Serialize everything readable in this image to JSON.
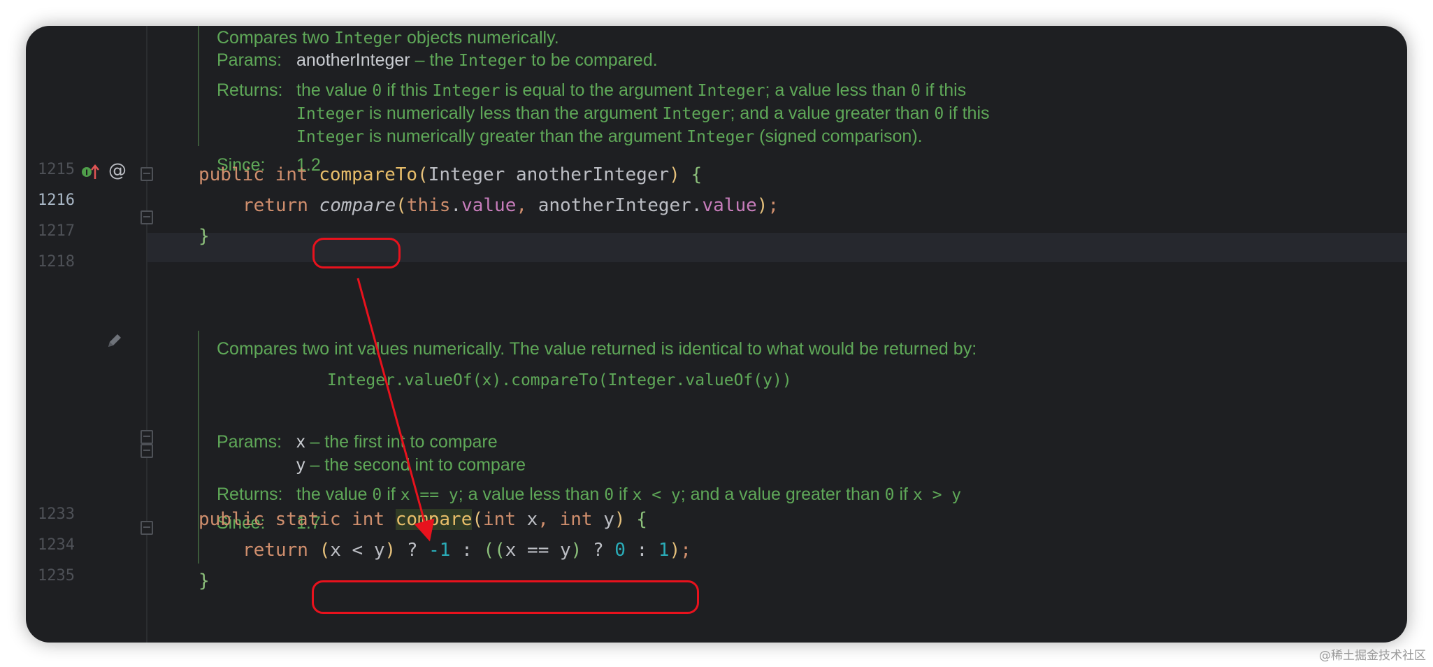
{
  "line_numbers": {
    "l1215": "1215",
    "l1216": "1216",
    "l1217": "1217",
    "l1218": "1218",
    "l1233": "1233",
    "l1234": "1234",
    "l1235": "1235"
  },
  "doc1": {
    "summary_a": "Compares two ",
    "summary_code": "Integer",
    "summary_b": " objects numerically.",
    "params_label": "Params:",
    "param_name": "anotherInteger",
    "param_a": " – the ",
    "param_code": "Integer",
    "param_b": " to be compared.",
    "returns_label": "Returns:",
    "ret1_a": "the value ",
    "ret1_c1": "0",
    "ret1_b": " if this ",
    "ret1_c2": "Integer",
    "ret1_c": " is equal to the argument ",
    "ret1_c3": "Integer",
    "ret1_d": "; a value less than ",
    "ret1_c4": "0",
    "ret1_e": " if this",
    "ret2_c1": "Integer",
    "ret2_a": " is numerically less than the argument ",
    "ret2_c2": "Integer",
    "ret2_b": "; and a value greater than ",
    "ret2_c3": "0",
    "ret2_c": " if this",
    "ret3_c1": "Integer",
    "ret3_a": " is numerically greater than the argument ",
    "ret3_c2": "Integer",
    "ret3_b": " (signed comparison).",
    "since_label": "Since:",
    "since_value": "1.2"
  },
  "code1": {
    "public": "public",
    "int": "int",
    "method": "compareTo",
    "open_paren": "(",
    "param_type": "Integer",
    "param_name": "anotherInteger",
    "close_paren": ")",
    "open_brace": "{",
    "return": "return",
    "call": "compare",
    "this": "this",
    "dot1": ".",
    "field1": "value",
    "comma": ",",
    "arg": "anotherInteger",
    "dot2": ".",
    "field2": "value",
    "end": ");",
    "close_brace": "}"
  },
  "doc2": {
    "summary": "Compares two int values numerically. The value returned is identical to what would be returned by:",
    "example": "Integer.valueOf(x).compareTo(Integer.valueOf(y))",
    "params_label": "Params:",
    "p1_name": "x",
    "p1_desc": " – the first int to compare",
    "p2_name": "y",
    "p2_desc": " – the second int to compare",
    "returns_label": "Returns:",
    "ret_a": "the value ",
    "ret_c1": "0",
    "ret_b": " if ",
    "ret_c2": "x == y",
    "ret_c": "; a value less than ",
    "ret_c3": "0",
    "ret_d": " if ",
    "ret_c4": "x < y",
    "ret_e": "; and a value greater than ",
    "ret_c5": "0",
    "ret_f": " if ",
    "ret_c6": "x > y",
    "since_label": "Since:",
    "since_value": "1.7"
  },
  "code2": {
    "public": "public",
    "static": "static",
    "int": "int",
    "method": "compare",
    "open_paren": "(",
    "int1": "int",
    "x": "x",
    "comma": ",",
    "int2": "int",
    "y": "y",
    "close_paren": ")",
    "open_brace": "{",
    "return": "return",
    "expr_open": "(",
    "x1": "x",
    "lt": "<",
    "y1": "y",
    "expr_close": ")",
    "q1": "?",
    "neg_one": "-1",
    "colon1": ":",
    "pp": "((",
    "x2": "x",
    "eq": "==",
    "y2": "y",
    "p_close": ")",
    "q2": "?",
    "zero": "0",
    "colon2": ":",
    "one": "1",
    "end": ");",
    "close_brace": "}"
  },
  "gutter": {
    "impl_icon": "override-up-arrow-icon",
    "annotation_icon": "@",
    "edit_icon": "pencil-icon"
  },
  "colors": {
    "annotation_red": "#e8121d",
    "doc_green": "#5fa858",
    "keyword": "#cf8e6d"
  },
  "watermark": "@稀土掘金技术社区"
}
